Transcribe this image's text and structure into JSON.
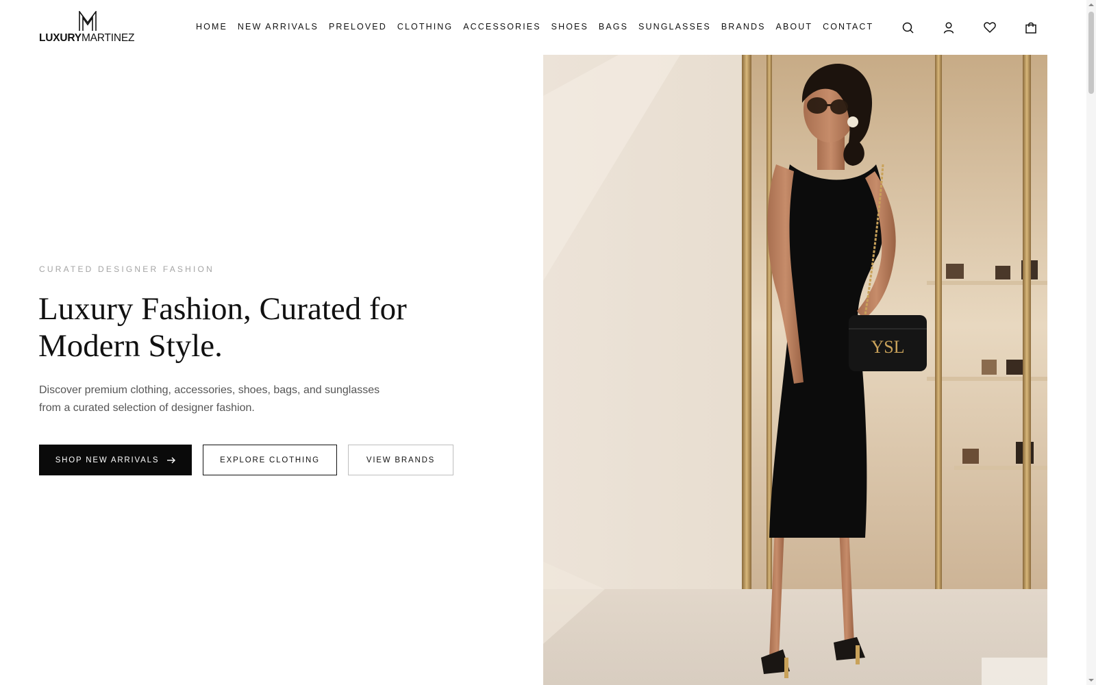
{
  "header": {
    "logo": {
      "bold": "LUXURY",
      "light": "MARTINEZ",
      "mark_icon": "mm-monogram-icon"
    },
    "nav": [
      {
        "label": "HOME"
      },
      {
        "label": "NEW ARRIVALS"
      },
      {
        "label": "PRELOVED"
      },
      {
        "label": "CLOTHING"
      },
      {
        "label": "ACCESSORIES"
      },
      {
        "label": "SHOES"
      },
      {
        "label": "BAGS"
      },
      {
        "label": "SUNGLASSES"
      },
      {
        "label": "BRANDS"
      },
      {
        "label": "ABOUT"
      },
      {
        "label": "CONTACT"
      }
    ],
    "icons": [
      "search-icon",
      "user-icon",
      "heart-icon",
      "shopping-bag-icon"
    ]
  },
  "hero": {
    "eyebrow": "CURATED DESIGNER FASHION",
    "headline_line1": "Luxury Fashion, Curated for",
    "headline_line2": "Modern Style.",
    "subtext_line1": "Discover premium clothing, accessories, shoes, bags, and sunglasses",
    "subtext_line2": "from a curated selection of designer fashion.",
    "buttons": {
      "primary": "SHOP NEW ARRIVALS",
      "secondary": "EXPLORE CLOTHING",
      "tertiary": "VIEW BRANDS"
    },
    "image_icon": "model-photo"
  },
  "colors": {
    "text": "#111111",
    "muted": "#a4a4a4",
    "button_dark": "#0a0a0a",
    "accent_gold": "#c9a25a"
  }
}
